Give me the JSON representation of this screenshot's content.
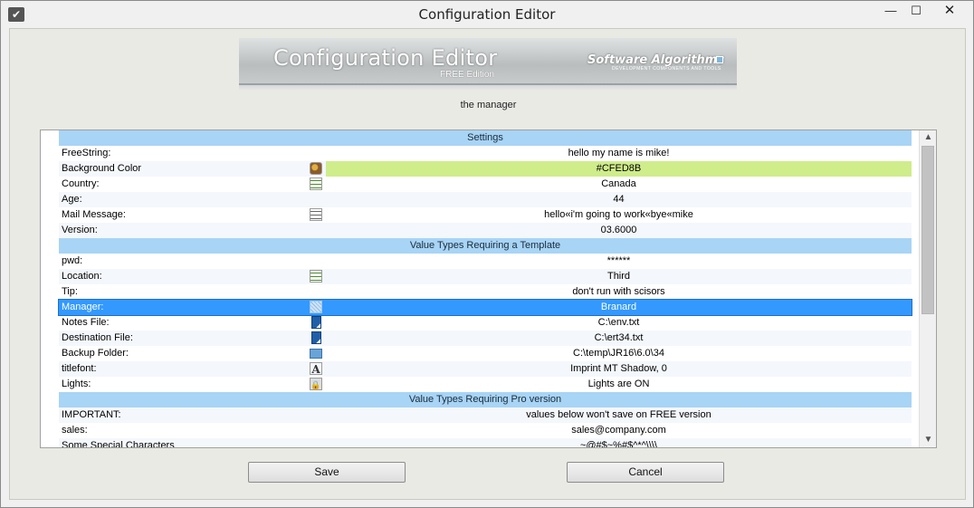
{
  "window": {
    "title": "Configuration Editor",
    "icon": "checkmark-app-icon",
    "min_glyph": "—",
    "max_glyph": "☐",
    "close_glyph": "✕"
  },
  "banner": {
    "title": "Configuration Editor",
    "edition": "FREE Edition",
    "brand": "Software Algorithms",
    "tagline": "DEVELOPMENT COMPONENTS AND TOOLS"
  },
  "subtitle": "the manager",
  "grid": {
    "rows": [
      {
        "type": "header",
        "value": "Settings"
      },
      {
        "name": "FreeString:",
        "value": "hello my name is mike!"
      },
      {
        "name": "Background Color",
        "icon": "palette-icon",
        "value": "#CFED8B",
        "swatch": "#cfed8b"
      },
      {
        "name": "Country:",
        "icon": "list-icon",
        "value": "Canada"
      },
      {
        "name": "Age:",
        "value": "44"
      },
      {
        "name": "Mail Message:",
        "icon": "text-lines-icon",
        "value": "hello«i'm going to work«bye«mike"
      },
      {
        "name": "Version:",
        "value": "03.6000"
      },
      {
        "type": "header",
        "value": "Value Types Requiring a Template"
      },
      {
        "name": "pwd:",
        "value": "******"
      },
      {
        "name": "Location:",
        "icon": "list-icon",
        "value": "Third"
      },
      {
        "name": "Tip:",
        "value": "don't run with scisors"
      },
      {
        "name": "Manager:",
        "icon": "manager-icon",
        "value": "Branard",
        "selected": true
      },
      {
        "name": "Notes File:",
        "icon": "file-icon",
        "value": "C:\\env.txt"
      },
      {
        "name": "Destination File:",
        "icon": "file-icon",
        "value": "C:\\ert34.txt"
      },
      {
        "name": "Backup Folder:",
        "icon": "folder-icon",
        "value": "C:\\temp\\JR16\\6.0\\34"
      },
      {
        "name": "titlefont:",
        "icon": "font-icon",
        "value": "Imprint MT Shadow, 0"
      },
      {
        "name": "Lights:",
        "icon": "lock-icon",
        "value": "Lights are ON"
      },
      {
        "type": "header",
        "value": "Value Types Requiring Pro version"
      },
      {
        "name": "IMPORTANT:",
        "value": "values below won't save on FREE version"
      },
      {
        "name": "sales:",
        "value": "sales@company.com"
      },
      {
        "name": "Some Special Characters",
        "value": "~@#$~%#$^*^\\\\\\\\"
      }
    ]
  },
  "scrollbar": {
    "up": "▲",
    "down": "▼"
  },
  "buttons": {
    "save": "Save",
    "cancel": "Cancel"
  }
}
